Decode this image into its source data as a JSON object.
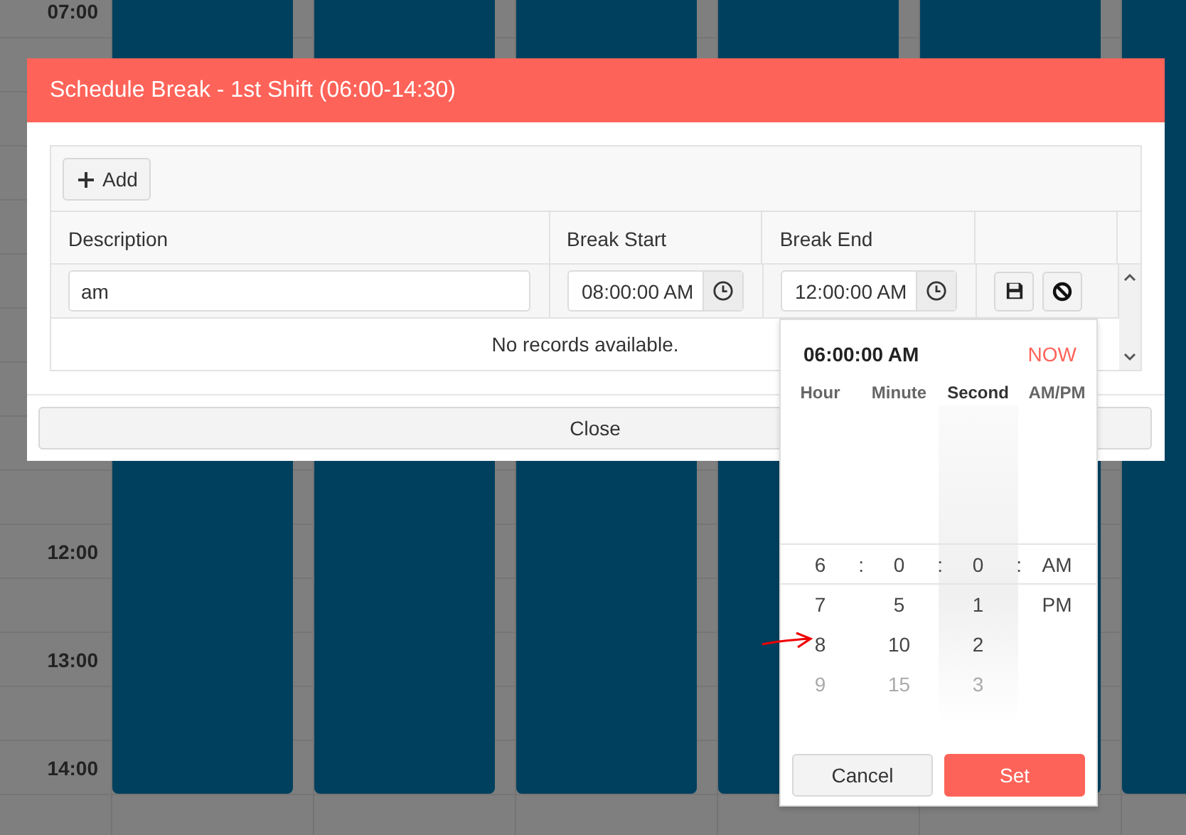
{
  "calendar": {
    "time_labels": [
      "07:00",
      "12:00",
      "13:00",
      "14:00"
    ],
    "columns": [
      {
        "kind": "shift"
      },
      {
        "kind": "shift"
      },
      {
        "kind": "shift"
      },
      {
        "kind": "shift"
      },
      {
        "kind": "shift"
      },
      {
        "kind": "shift"
      }
    ]
  },
  "dialog": {
    "title": "Schedule Break - 1st Shift (06:00-14:30)",
    "add_button": "Add",
    "columns": [
      "Description",
      "Break Start",
      "Break End"
    ],
    "edit_row": {
      "description": "am",
      "break_start": "08:00:00 AM",
      "break_end": "12:00:00 AM"
    },
    "empty_message": "No records available.",
    "close_button": "Close"
  },
  "time_picker": {
    "current": "06:00:00 AM",
    "now_button": "NOW",
    "separator": ":",
    "columns": [
      {
        "label": "Hour",
        "selected": false,
        "values": [
          "6",
          "7",
          "8",
          "9"
        ]
      },
      {
        "label": "Minute",
        "selected": false,
        "values": [
          "0",
          "5",
          "10",
          "15"
        ]
      },
      {
        "label": "Second",
        "selected": true,
        "values": [
          "0",
          "1",
          "2",
          "3"
        ]
      },
      {
        "label": "AM/PM",
        "selected": false,
        "values": [
          "AM",
          "PM"
        ]
      }
    ],
    "cancel_button": "Cancel",
    "set_button": "Set"
  }
}
